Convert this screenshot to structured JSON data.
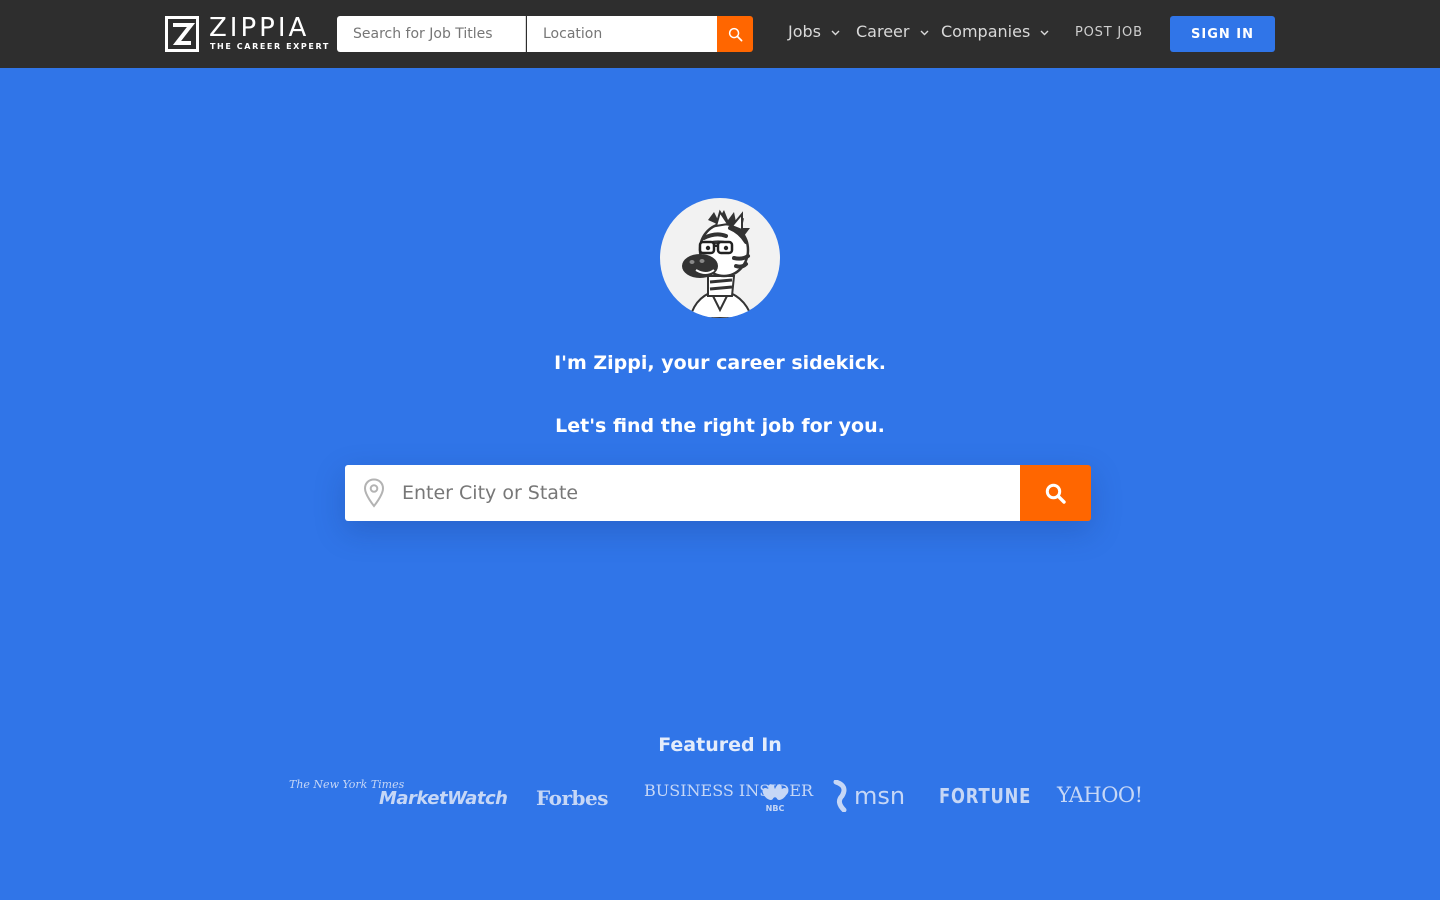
{
  "header": {
    "logo_text": "ZIPPIA",
    "logo_tagline": "THE CAREER EXPERT",
    "job_search_placeholder": "Search for Job Titles",
    "location_placeholder": "Location",
    "nav": [
      {
        "label": "Jobs"
      },
      {
        "label": "Career"
      },
      {
        "label": "Companies"
      }
    ],
    "post_job_label": "POST JOB",
    "sign_in_label": "SIGN IN"
  },
  "hero": {
    "intro": "I'm Zippi, your career sidekick.",
    "subtitle": "Let's find the right job for you.",
    "location_placeholder": "Enter City or State"
  },
  "featured": {
    "title": "Featured In",
    "logos": [
      {
        "name": "new-york-times",
        "text": "The New York Times"
      },
      {
        "name": "marketwatch",
        "text": "MarketWatch"
      },
      {
        "name": "forbes",
        "text": "Forbes"
      },
      {
        "name": "business-insider",
        "text": "BUSINESS INSIDER"
      },
      {
        "name": "nbc",
        "text": "NBC"
      },
      {
        "name": "msn",
        "text": "msn"
      },
      {
        "name": "fortune",
        "text": "FORTUNE"
      },
      {
        "name": "yahoo",
        "text": "YAHOO!"
      }
    ]
  },
  "colors": {
    "header_bg": "#2e2e2e",
    "page_bg": "#3075e8",
    "accent_orange": "#ff6600",
    "sign_in_bg": "#3075e8"
  },
  "icons": [
    "zippia-logo-icon",
    "search-icon",
    "chevron-down-icon",
    "zebra-mascot-avatar",
    "location-pin-icon"
  ]
}
